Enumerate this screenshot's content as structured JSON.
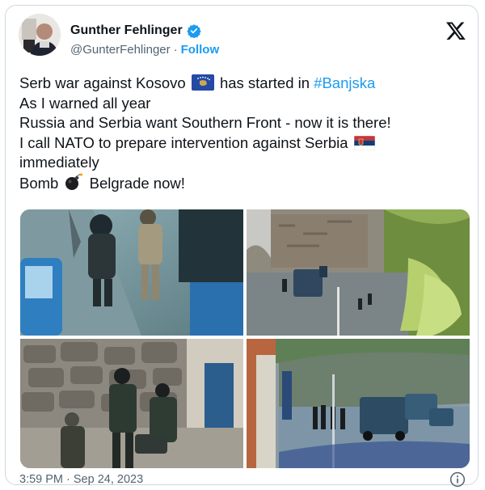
{
  "author": {
    "name": "Gunther Fehlinger",
    "handle": "@GunterFehlinger",
    "separator": "·",
    "follow_label": "Follow",
    "verified": true
  },
  "tweet": {
    "line1_prefix": "Serb war against Kosovo",
    "line1_middle": "has started in",
    "hashtag": "#Banjska",
    "line2": "As I warned all year",
    "line3": "Russia and Serbia want Southern Front - now it is there!",
    "line4": "I call NATO to prepare intervention against Serbia",
    "line5": "immediately",
    "line6_prefix": "Bomb",
    "line6_suffix": "Belgrade now!"
  },
  "timestamp": "3:59 PM · Sep 24, 2023",
  "colors": {
    "link": "#1d9bf0",
    "text": "#0f1419",
    "secondary": "#536471",
    "border": "#cfd9de"
  },
  "icons": [
    "verified-badge-icon",
    "x-logo-icon",
    "kosovo-flag-icon",
    "serbia-flag-icon",
    "bomb-icon",
    "info-icon"
  ]
}
